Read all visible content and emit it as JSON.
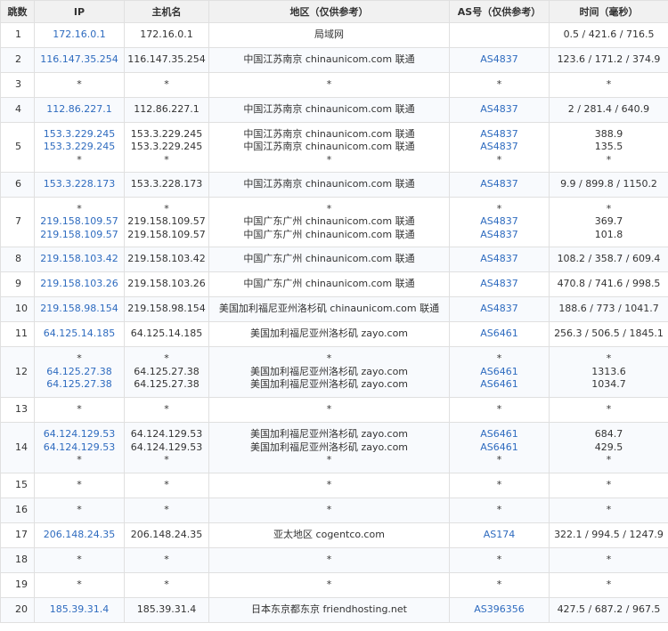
{
  "headers": [
    "跳数",
    "IP",
    "主机名",
    "地区（仅供参考）",
    "AS号（仅供参考）",
    "时间（毫秒）"
  ],
  "rows": [
    {
      "hop": "1",
      "ip": [
        "172.16.0.1"
      ],
      "host": [
        "172.16.0.1"
      ],
      "region": [
        "局域网"
      ],
      "as": [
        ""
      ],
      "time": [
        "0.5 / 421.6 / 716.5"
      ]
    },
    {
      "hop": "2",
      "ip": [
        "116.147.35.254"
      ],
      "host": [
        "116.147.35.254"
      ],
      "region": [
        "中国江苏南京 chinaunicom.com 联通"
      ],
      "as": [
        "AS4837"
      ],
      "time": [
        "123.6 / 171.2 / 374.9"
      ]
    },
    {
      "hop": "3",
      "ip": [
        "*"
      ],
      "host": [
        "*"
      ],
      "region": [
        "*"
      ],
      "as": [
        "*"
      ],
      "time": [
        "*"
      ]
    },
    {
      "hop": "4",
      "ip": [
        "112.86.227.1"
      ],
      "host": [
        "112.86.227.1"
      ],
      "region": [
        "中国江苏南京 chinaunicom.com 联通"
      ],
      "as": [
        "AS4837"
      ],
      "time": [
        "2 / 281.4 / 640.9"
      ]
    },
    {
      "hop": "5",
      "ip": [
        "153.3.229.245",
        "153.3.229.245",
        "*"
      ],
      "host": [
        "153.3.229.245",
        "153.3.229.245",
        "*"
      ],
      "region": [
        "中国江苏南京 chinaunicom.com 联通",
        "中国江苏南京 chinaunicom.com 联通",
        "*"
      ],
      "as": [
        "AS4837",
        "AS4837",
        "*"
      ],
      "time": [
        "388.9",
        "135.5",
        "*"
      ]
    },
    {
      "hop": "6",
      "ip": [
        "153.3.228.173"
      ],
      "host": [
        "153.3.228.173"
      ],
      "region": [
        "中国江苏南京 chinaunicom.com 联通"
      ],
      "as": [
        "AS4837"
      ],
      "time": [
        "9.9 / 899.8 / 1150.2"
      ]
    },
    {
      "hop": "7",
      "ip": [
        "*",
        "219.158.109.57",
        "219.158.109.57"
      ],
      "host": [
        "*",
        "219.158.109.57",
        "219.158.109.57"
      ],
      "region": [
        "*",
        "中国广东广州 chinaunicom.com 联通",
        "中国广东广州 chinaunicom.com 联通"
      ],
      "as": [
        "*",
        "AS4837",
        "AS4837"
      ],
      "time": [
        "*",
        "369.7",
        "101.8"
      ]
    },
    {
      "hop": "8",
      "ip": [
        "219.158.103.42"
      ],
      "host": [
        "219.158.103.42"
      ],
      "region": [
        "中国广东广州 chinaunicom.com 联通"
      ],
      "as": [
        "AS4837"
      ],
      "time": [
        "108.2 / 358.7 / 609.4"
      ]
    },
    {
      "hop": "9",
      "ip": [
        "219.158.103.26"
      ],
      "host": [
        "219.158.103.26"
      ],
      "region": [
        "中国广东广州 chinaunicom.com 联通"
      ],
      "as": [
        "AS4837"
      ],
      "time": [
        "470.8 / 741.6 / 998.5"
      ]
    },
    {
      "hop": "10",
      "ip": [
        "219.158.98.154"
      ],
      "host": [
        "219.158.98.154"
      ],
      "region": [
        "美国加利福尼亚州洛杉矶 chinaunicom.com 联通"
      ],
      "as": [
        "AS4837"
      ],
      "time": [
        "188.6 / 773 / 1041.7"
      ]
    },
    {
      "hop": "11",
      "ip": [
        "64.125.14.185"
      ],
      "host": [
        "64.125.14.185"
      ],
      "region": [
        "美国加利福尼亚州洛杉矶 zayo.com"
      ],
      "as": [
        "AS6461"
      ],
      "time": [
        "256.3 / 506.5 / 1845.1"
      ]
    },
    {
      "hop": "12",
      "ip": [
        "*",
        "64.125.27.38",
        "64.125.27.38"
      ],
      "host": [
        "*",
        "64.125.27.38",
        "64.125.27.38"
      ],
      "region": [
        "*",
        "美国加利福尼亚州洛杉矶 zayo.com",
        "美国加利福尼亚州洛杉矶 zayo.com"
      ],
      "as": [
        "*",
        "AS6461",
        "AS6461"
      ],
      "time": [
        "*",
        "1313.6",
        "1034.7"
      ]
    },
    {
      "hop": "13",
      "ip": [
        "*"
      ],
      "host": [
        "*"
      ],
      "region": [
        "*"
      ],
      "as": [
        "*"
      ],
      "time": [
        "*"
      ]
    },
    {
      "hop": "14",
      "ip": [
        "64.124.129.53",
        "64.124.129.53",
        "*"
      ],
      "host": [
        "64.124.129.53",
        "64.124.129.53",
        "*"
      ],
      "region": [
        "美国加利福尼亚州洛杉矶 zayo.com",
        "美国加利福尼亚州洛杉矶 zayo.com",
        "*"
      ],
      "as": [
        "AS6461",
        "AS6461",
        "*"
      ],
      "time": [
        "684.7",
        "429.5",
        "*"
      ]
    },
    {
      "hop": "15",
      "ip": [
        "*"
      ],
      "host": [
        "*"
      ],
      "region": [
        "*"
      ],
      "as": [
        "*"
      ],
      "time": [
        "*"
      ]
    },
    {
      "hop": "16",
      "ip": [
        "*"
      ],
      "host": [
        "*"
      ],
      "region": [
        "*"
      ],
      "as": [
        "*"
      ],
      "time": [
        "*"
      ]
    },
    {
      "hop": "17",
      "ip": [
        "206.148.24.35"
      ],
      "host": [
        "206.148.24.35"
      ],
      "region": [
        "亚太地区 cogentco.com"
      ],
      "as": [
        "AS174"
      ],
      "time": [
        "322.1 / 994.5 / 1247.9"
      ]
    },
    {
      "hop": "18",
      "ip": [
        "*"
      ],
      "host": [
        "*"
      ],
      "region": [
        "*"
      ],
      "as": [
        "*"
      ],
      "time": [
        "*"
      ]
    },
    {
      "hop": "19",
      "ip": [
        "*"
      ],
      "host": [
        "*"
      ],
      "region": [
        "*"
      ],
      "as": [
        "*"
      ],
      "time": [
        "*"
      ]
    },
    {
      "hop": "20",
      "ip": [
        "185.39.31.4"
      ],
      "host": [
        "185.39.31.4"
      ],
      "region": [
        "日本东京都东京 friendhosting.net"
      ],
      "as": [
        "AS396356"
      ],
      "time": [
        "427.5 / 687.2 / 967.5"
      ]
    }
  ],
  "colors": {
    "header_bg": "#f1f1f1",
    "link": "#2e6bbf",
    "border": "#e0e0e0",
    "row_alt": "#f8fafd"
  }
}
